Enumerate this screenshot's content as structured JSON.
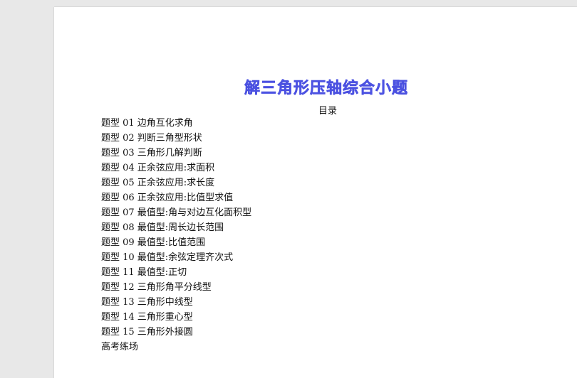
{
  "document": {
    "title": "解三角形压轴综合小题",
    "toc_heading": "目录",
    "toc_items": [
      "题型 01 边角互化求角",
      "题型 02 判断三角型形状",
      "题型 03 三角形几解判断",
      "题型 04 正余弦应用:求面积",
      "题型 05 正余弦应用:求长度",
      "题型 06 正余弦应用:比值型求值",
      "题型 07 最值型:角与对边互化面积型",
      "题型 08 最值型:周长边长范围",
      "题型 09 最值型:比值范围",
      "题型 10 最值型:余弦定理齐次式",
      "题型 11 最值型:正切",
      "题型 12 三角形角平分线型",
      "题型 13 三角形中线型",
      "题型 14 三角形重心型",
      "题型 15 三角形外接圆",
      "高考练场"
    ]
  },
  "colors": {
    "title": "#5b62f2",
    "page_background": "#ffffff",
    "viewer_background": "#e8e8e8"
  }
}
